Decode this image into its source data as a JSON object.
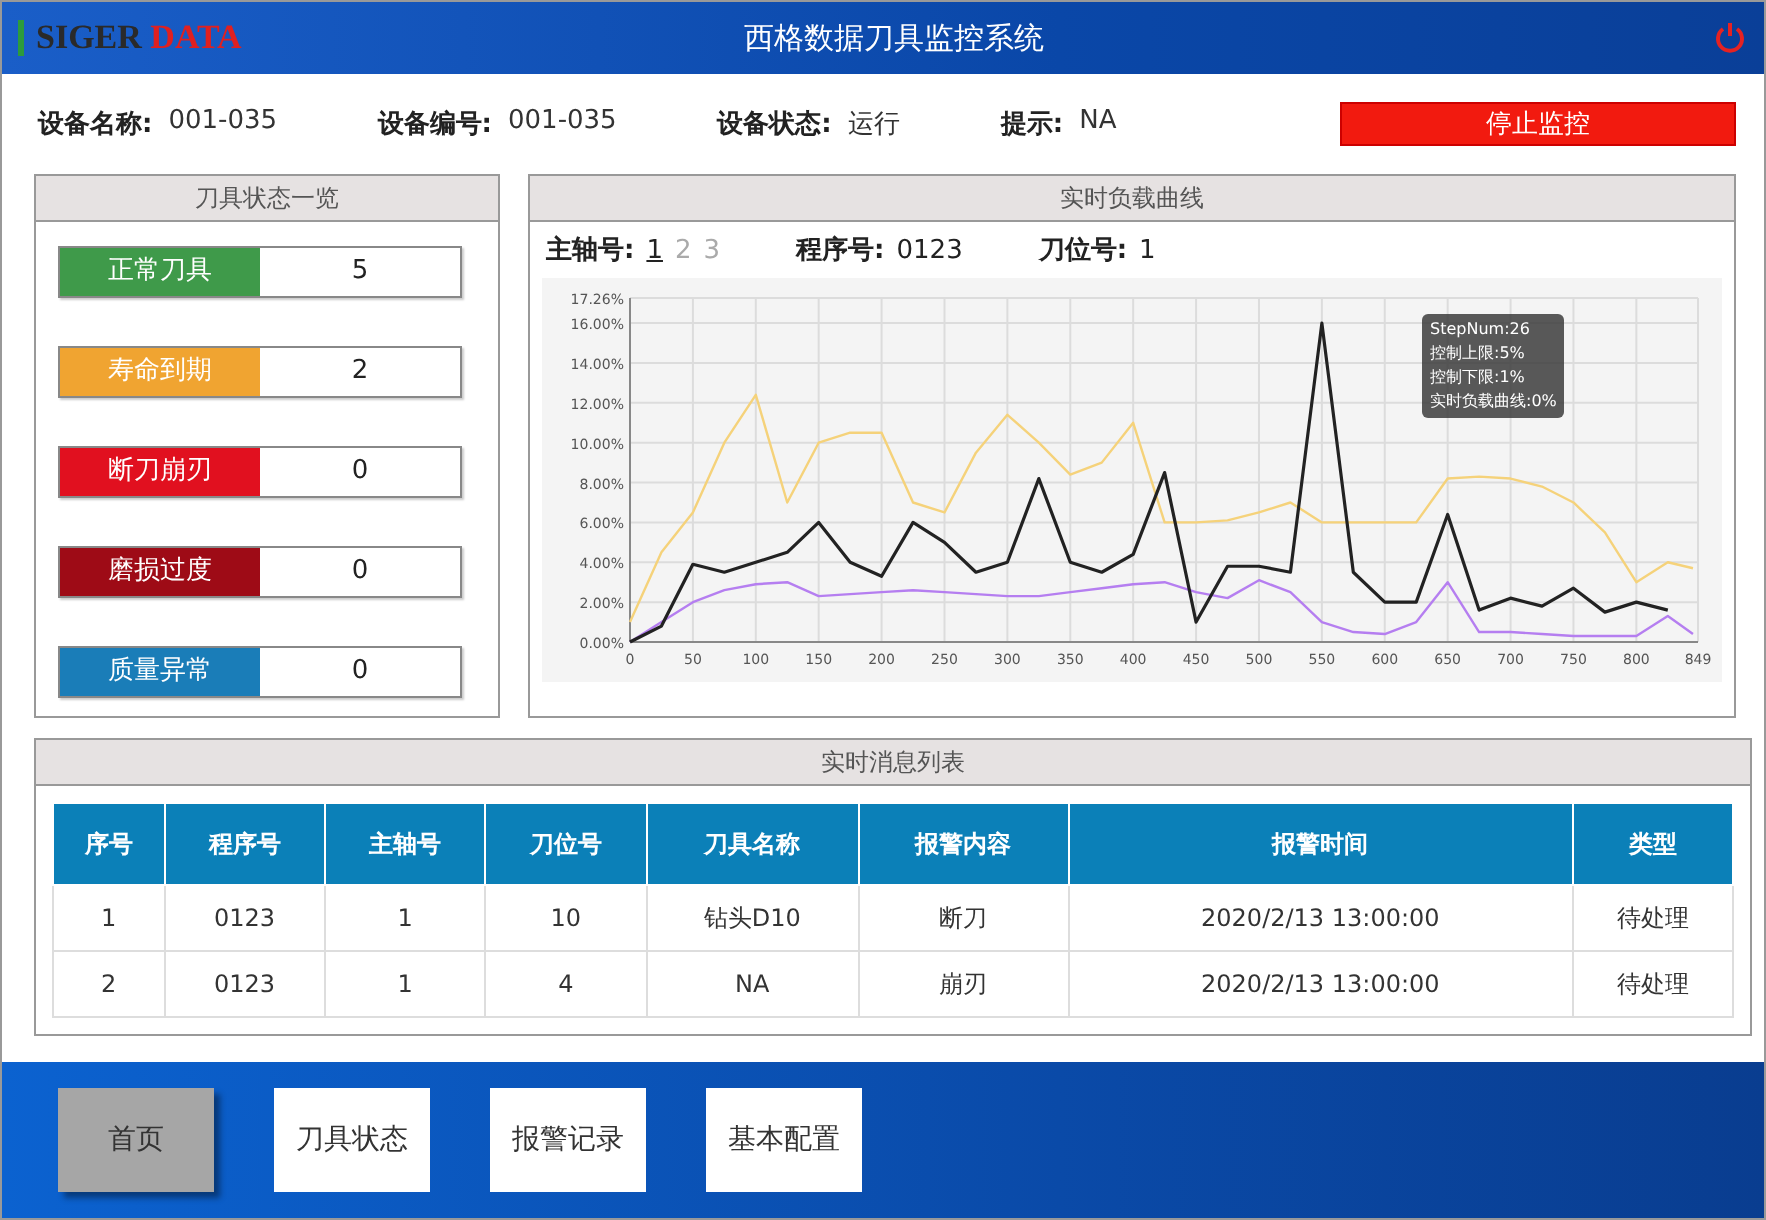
{
  "header": {
    "logo_part1": "SIGER",
    "logo_part2": "DATA",
    "title": "西格数据刀具监控系统"
  },
  "info": [
    {
      "label": "设备名称:",
      "value": "001-035"
    },
    {
      "label": "设备编号:",
      "value": "001-035"
    },
    {
      "label": "设备状态:",
      "value": "运行"
    },
    {
      "label": "提示:",
      "value": "NA"
    }
  ],
  "stop_button": "停止监控",
  "status_panel": {
    "title": "刀具状态一览",
    "items": [
      {
        "label": "正常刀具",
        "count": "5",
        "color": "#3f9a4a"
      },
      {
        "label": "寿命到期",
        "count": "2",
        "color": "#f0a431"
      },
      {
        "label": "断刀崩刃",
        "count": "0",
        "color": "#e1101f"
      },
      {
        "label": "磨损过度",
        "count": "0",
        "color": "#9e0b16"
      },
      {
        "label": "质量异常",
        "count": "0",
        "color": "#1a7db8"
      }
    ]
  },
  "load_panel": {
    "title": "实时负载曲线",
    "spindle_label": "主轴号:",
    "spindles": [
      {
        "label": "1",
        "selected": true
      },
      {
        "label": "2",
        "selected": false
      },
      {
        "label": "3",
        "selected": false
      }
    ],
    "program_label": "程序号:",
    "program": "0123",
    "tool_label": "刀位号:",
    "tool": "1",
    "tooltip": {
      "title": "StepNum:26",
      "values": [
        ":5%",
        ":1%",
        ":0%"
      ]
    },
    "chart_data": {
      "type": "line",
      "x": [
        0,
        25,
        50,
        75,
        100,
        125,
        150,
        175,
        200,
        225,
        250,
        275,
        300,
        325,
        350,
        375,
        400,
        425,
        450,
        475,
        500,
        525,
        550,
        575,
        600,
        625,
        650,
        675,
        700,
        725,
        750,
        775,
        800,
        825,
        845
      ],
      "series": [
        {
          "name": "控制上限",
          "color": "#f5d27a",
          "values": [
            1,
            4.5,
            6.5,
            10,
            12.4,
            7,
            10,
            10.5,
            10.5,
            7,
            6.5,
            9.5,
            11.4,
            10,
            8.4,
            9,
            11,
            6,
            6,
            6.1,
            6.5,
            7,
            6,
            6,
            6,
            6,
            8.2,
            8.3,
            8.2,
            7.8,
            7,
            5.5,
            3,
            4,
            3.7
          ]
        },
        {
          "name": "控制下限",
          "color": "#b57ef0",
          "values": [
            0,
            1,
            2,
            2.6,
            2.9,
            3,
            2.3,
            2.4,
            2.5,
            2.6,
            2.5,
            2.4,
            2.3,
            2.3,
            2.5,
            2.7,
            2.9,
            3,
            2.5,
            2.2,
            3.1,
            2.5,
            1,
            0.5,
            0.4,
            1,
            3,
            0.5,
            0.5,
            0.4,
            0.3,
            0.3,
            0.3,
            1.3,
            0.4
          ]
        },
        {
          "name": "实时负载曲线",
          "color": "#222222",
          "values": [
            0,
            0.8,
            3.9,
            3.5,
            4,
            4.5,
            6,
            4,
            3.3,
            6,
            5,
            3.5,
            4,
            8.2,
            4,
            3.5,
            4.4,
            8.5,
            1,
            3.8,
            3.8,
            3.5,
            16,
            3.5,
            2,
            2,
            6.4,
            1.6,
            2.2,
            1.8,
            2.7,
            1.5,
            2,
            1.6,
            null
          ]
        }
      ],
      "grid": true,
      "xlim": [
        0,
        849
      ],
      "ylim": [
        0,
        17.26
      ],
      "xticks": [
        0,
        50,
        100,
        150,
        200,
        250,
        300,
        350,
        400,
        450,
        500,
        550,
        600,
        650,
        700,
        750,
        800,
        849
      ],
      "yticks": [
        {
          "value": 0,
          "label": "0.00%"
        },
        {
          "value": 2,
          "label": "2.00%"
        },
        {
          "value": 4,
          "label": "4.00%"
        },
        {
          "value": 6,
          "label": "6.00%"
        },
        {
          "value": 8,
          "label": "8.00%"
        },
        {
          "value": 10,
          "label": "10.00%"
        },
        {
          "value": 12,
          "label": "12.00%"
        },
        {
          "value": 14,
          "label": "14.00%"
        },
        {
          "value": 16,
          "label": "16.00%"
        },
        {
          "value": 17.26,
          "label": "17.26%"
        }
      ]
    }
  },
  "message_panel": {
    "title": "实时消息列表",
    "columns": [
      "序号",
      "程序号",
      "主轴号",
      "刀位号",
      "刀具名称",
      "报警内容",
      "报警时间",
      "类型"
    ],
    "rows": [
      [
        "1",
        "0123",
        "1",
        "10",
        "钻头D10",
        "断刀",
        "2020/2/13 13:00:00",
        "待处理"
      ],
      [
        "2",
        "0123",
        "1",
        "4",
        "NA",
        "崩刃",
        "2020/2/13 13:00:00",
        "待处理"
      ]
    ]
  },
  "nav": [
    {
      "label": "首页",
      "selected": true
    },
    {
      "label": "刀具状态",
      "selected": false
    },
    {
      "label": "报警记录",
      "selected": false
    },
    {
      "label": "基本配置",
      "selected": false
    }
  ]
}
